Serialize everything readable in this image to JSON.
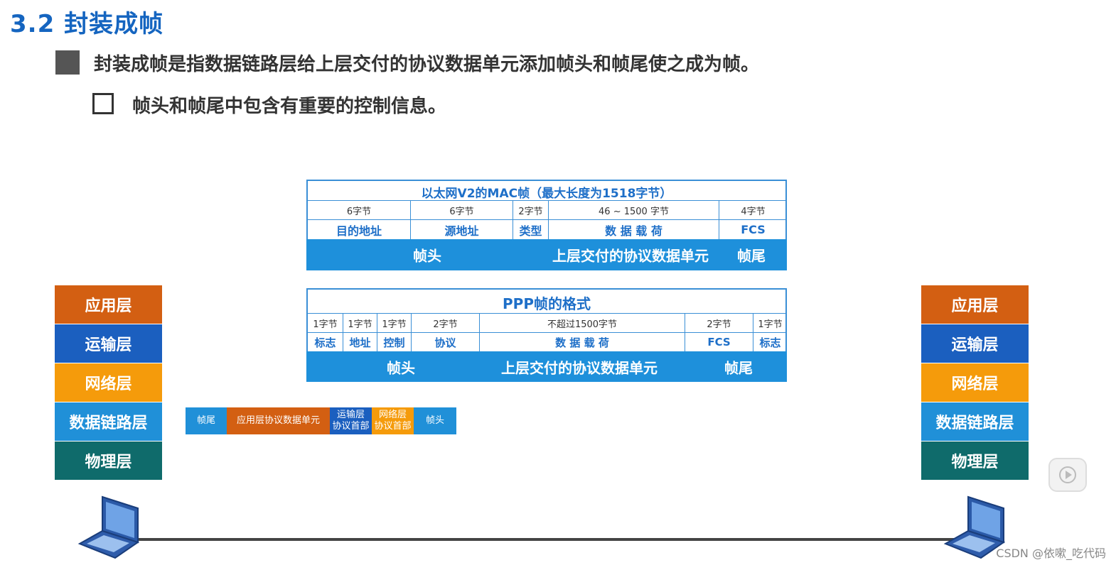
{
  "heading": "3.2 封装成帧",
  "bullet1": "封装成帧是指数据链路层给上层交付的协议数据单元添加帧头和帧尾使之成为帧。",
  "bullet2": "帧头和帧尾中包含有重要的控制信息。",
  "ethernet": {
    "title": "以太网V2的MAC帧（最大长度为1518字节）",
    "sizes": [
      "6字节",
      "6字节",
      "2字节",
      "46 ~ 1500 字节",
      "4字节"
    ],
    "fields": [
      "目的地址",
      "源地址",
      "类型",
      "数 据 载 荷",
      "FCS"
    ],
    "bar": [
      "帧头",
      "上层交付的协议数据单元",
      "帧尾"
    ]
  },
  "ppp": {
    "title": "PPP帧的格式",
    "sizes": [
      "1字节",
      "1字节",
      "1字节",
      "2字节",
      "不超过1500字节",
      "2字节",
      "1字节"
    ],
    "fields": [
      "标志",
      "地址",
      "控制",
      "协议",
      "数 据 载 荷",
      "FCS",
      "标志"
    ],
    "bar": [
      "帧头",
      "上层交付的协议数据单元",
      "帧尾"
    ]
  },
  "layers": [
    "应用层",
    "运输层",
    "网络层",
    "数据链路层",
    "物理层"
  ],
  "layer_colors": [
    "#d35f12",
    "#1b5fbf",
    "#f59b0b",
    "#2090d8",
    "#0f6b6b"
  ],
  "strip": {
    "tail": "帧尾",
    "app": "应用层协议数据单元",
    "transport": "运输层\n协议首部",
    "network": "网络层\n协议首部",
    "head": "帧头"
  },
  "watermark": "CSDN @依嗽_吃代码",
  "icons": {
    "play": "play-icon",
    "laptop": "laptop-icon"
  }
}
